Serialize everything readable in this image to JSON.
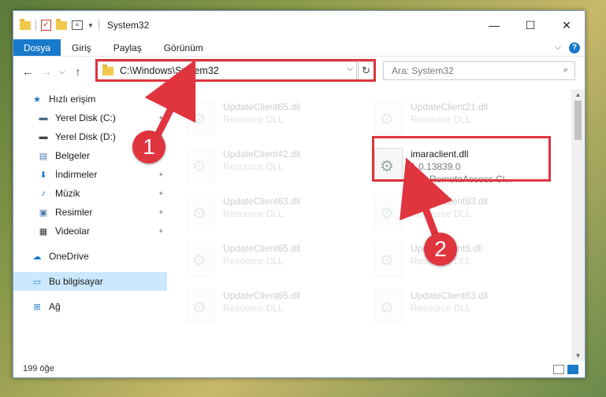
{
  "window": {
    "title": "System32",
    "minimize": "—",
    "maximize": "☐",
    "close": "✕"
  },
  "ribbon": {
    "tabs": [
      "Dosya",
      "Giriş",
      "Paylaş",
      "Görünüm"
    ],
    "expand": "⌵",
    "help": "?"
  },
  "nav": {
    "back": "←",
    "forward": "→",
    "dropdown": "⌵",
    "up": "↑",
    "address": "C:\\Windows\\System32",
    "refresh": "↻",
    "search_placeholder": "Ara: System32",
    "search_icon": "⌕"
  },
  "sidebar": {
    "items": [
      {
        "label": "Hızlı erişim",
        "icon": "star-icon",
        "glyph": "★",
        "color": "#1979ca",
        "pinned": false
      },
      {
        "label": "Yerel Disk (C:)",
        "icon": "drive-icon",
        "glyph": "▬",
        "color": "#4a6a8a",
        "pinned": true
      },
      {
        "label": "Yerel Disk (D:)",
        "icon": "drive-icon",
        "glyph": "▬",
        "color": "#444",
        "pinned": true
      },
      {
        "label": "Belgeler",
        "icon": "documents-icon",
        "glyph": "▤",
        "color": "#4a7ab0",
        "pinned": true
      },
      {
        "label": "İndirmeler",
        "icon": "download-icon",
        "glyph": "⬇",
        "color": "#1979ca",
        "pinned": true
      },
      {
        "label": "Müzik",
        "icon": "music-icon",
        "glyph": "♪",
        "color": "#1979ca",
        "pinned": true
      },
      {
        "label": "Resimler",
        "icon": "pictures-icon",
        "glyph": "▣",
        "color": "#4a7ab0",
        "pinned": true
      },
      {
        "label": "Videolar",
        "icon": "videos-icon",
        "glyph": "▦",
        "color": "#333",
        "pinned": true
      },
      {
        "label": "OneDrive",
        "icon": "cloud-icon",
        "glyph": "☁",
        "color": "#1979ca",
        "pinned": false
      },
      {
        "label": "Bu bilgisayar",
        "icon": "computer-icon",
        "glyph": "▭",
        "color": "#1979ca",
        "pinned": false
      },
      {
        "label": "Ağ",
        "icon": "network-icon",
        "glyph": "⊞",
        "color": "#1979ca",
        "pinned": false
      }
    ],
    "pin_glyph": "📌"
  },
  "files": {
    "left": [
      {
        "name": "UpdateClient65.dll",
        "type": "Resource DLL"
      },
      {
        "name": "UpdateClient42.dll",
        "type": "Resource DLL"
      },
      {
        "name": "UpdateClient63.dll",
        "type": "Resource DLL"
      },
      {
        "name": "UpdateClient65.dll",
        "type": "Resource DLL"
      },
      {
        "name": "UpdateClient65.dll",
        "type": "Resource DLL"
      }
    ],
    "right": [
      {
        "name": "UpdateClient21.dll",
        "type": "Resource DLL"
      },
      {
        "name": "imaraclient.dll",
        "version": "1.0.13839.0",
        "type": "IMA RemoteAccess Cl...",
        "highlight": true
      },
      {
        "name": "UpdateClient63.dll",
        "type": "Resource DLL"
      },
      {
        "name": "UpdateClient5.dll",
        "type": "Resource DLL"
      },
      {
        "name": "UpdateClient63.dll",
        "type": "Resource DLL"
      }
    ]
  },
  "status": {
    "count": "199 öğe"
  },
  "annotations": {
    "step1": "1",
    "step2": "2",
    "accent": "#e0343e"
  }
}
